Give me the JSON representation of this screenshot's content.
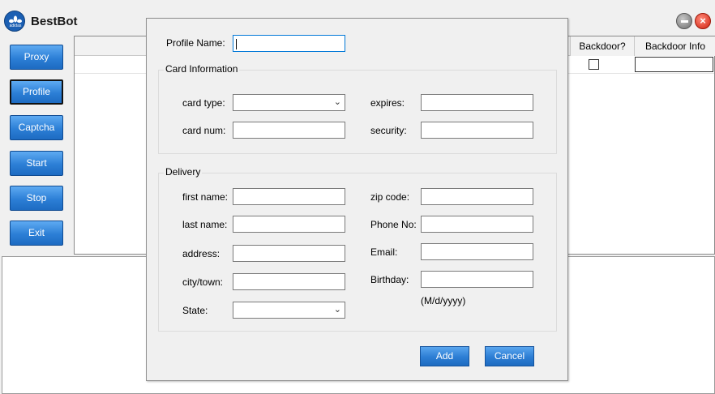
{
  "app": {
    "title": "BestBot",
    "logo_text": "adidas"
  },
  "nav": {
    "proxy": "Proxy",
    "profile": "Profile",
    "captcha": "Captcha",
    "start": "Start",
    "stop": "Stop",
    "exit": "Exit"
  },
  "grid": {
    "columns": [
      "Backdoor?",
      "Backdoor Info"
    ],
    "rows": [
      {
        "backdoor": false,
        "backdoor_info": ""
      }
    ]
  },
  "dialog": {
    "profile_name_label": "Profile Name:",
    "profile_name_value": "",
    "card_group": {
      "title": "Card Information",
      "card_type_label": "card type:",
      "card_type_value": "",
      "card_num_label": "card num:",
      "card_num_value": "",
      "expires_label": "expires:",
      "expires_value": "",
      "security_label": "security:",
      "security_value": ""
    },
    "delivery_group": {
      "title": "Delivery",
      "first_name_label": "first name:",
      "last_name_label": "last name:",
      "address_label": "address:",
      "city_label": "city/town:",
      "state_label": "State:",
      "state_value": "",
      "zip_label": "zip code:",
      "phone_label": "Phone No:",
      "email_label": "Email:",
      "birthday_label": "Birthday:",
      "birthday_hint": "(M/d/yyyy)"
    },
    "add_button": "Add",
    "cancel_button": "Cancel"
  },
  "colors": {
    "button_blue": "#2c7fd6",
    "close_red": "#d0200e",
    "focus_blue": "#0078d7"
  }
}
